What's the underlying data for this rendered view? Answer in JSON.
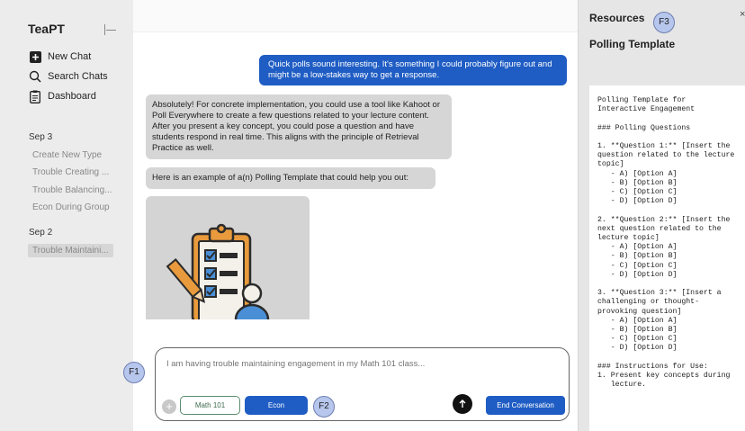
{
  "sidebar": {
    "brand": "TeaPT",
    "nav": [
      {
        "label": "New Chat",
        "icon": "plus-square-icon"
      },
      {
        "label": "Search Chats",
        "icon": "search-icon"
      },
      {
        "label": "Dashboard",
        "icon": "clipboard-icon"
      }
    ],
    "groups": [
      {
        "label": "Sep 3",
        "items": [
          "Create New Type",
          "Trouble Creating ...",
          "Trouble Balancing...",
          "Econ During Group"
        ]
      },
      {
        "label": "Sep 2",
        "items": [
          "Trouble Maintaini..."
        ]
      }
    ]
  },
  "chat": {
    "user_message": "Quick polls sound interesting. It's something I could probably figure out and might be a low-stakes way to get a response.",
    "ai_message_1": "Absolutely! For concrete implementation, you could use a tool like Kahoot or Poll Everywhere to create a few questions related to your lecture content. After you present a key concept, you could pose a question and have students respond in real time. This aligns with the principle of Retrieval Practice as well.",
    "ai_message_2": "Here is an example of a(n) Polling Template that could help you out:",
    "image_icon": "clipboard-checklist-illustration"
  },
  "composer": {
    "input_value": "I am having trouble maintaining engagement in my Math 101 class...",
    "chip_course": "Math 101",
    "chip_subject": "Econ",
    "send_icon": "arrow-up-icon",
    "end_label": "End Conversation"
  },
  "badges": {
    "f1": "F1",
    "f2": "F2",
    "f3": "F3"
  },
  "panel": {
    "title": "Resources",
    "close": "×",
    "subtitle": "Polling Template",
    "document": "Polling Template for\nInteractive Engagement\n\n### Polling Questions\n\n1. **Question 1:** [Insert the\nquestion related to the lecture\ntopic]\n   - A) [Option A]\n   - B) [Option B]\n   - C) [Option C]\n   - D) [Option D]\n\n2. **Question 2:** [Insert the\nnext question related to the\nlecture topic]\n   - A) [Option A]\n   - B) [Option B]\n   - C) [Option C]\n   - D) [Option D]\n\n3. **Question 3:** [Insert a\nchallenging or thought-\nprovoking question]\n   - A) [Option A]\n   - B) [Option B]\n   - C) [Option C]\n   - D) [Option D]\n\n### Instructions for Use:\n1. Present key concepts during\n   lecture."
  },
  "colors": {
    "accent": "#1f5dc4",
    "sidebar_bg": "#ececec",
    "panel_bg": "#e6e6e6",
    "ai_bubble": "#d6d6d6",
    "badge": "#b7c6ec"
  }
}
